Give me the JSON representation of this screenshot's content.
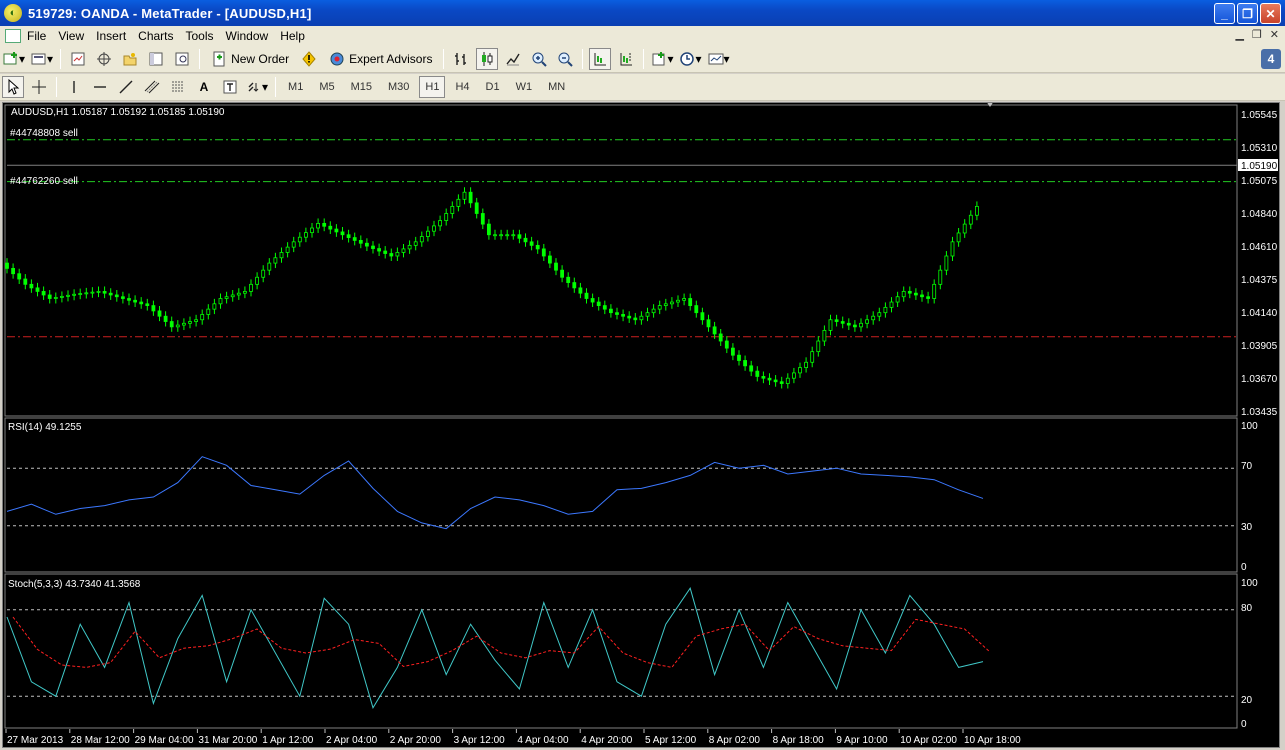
{
  "window": {
    "title": "519729: OANDA - MetaTrader - [AUDUSD,H1]"
  },
  "menu": [
    "File",
    "View",
    "Insert",
    "Charts",
    "Tools",
    "Window",
    "Help"
  ],
  "toolbar": {
    "new_order_label": "New Order",
    "expert_advisors_label": "Expert Advisors",
    "count_badge": "4"
  },
  "timeframes": [
    {
      "label": "M1",
      "active": false
    },
    {
      "label": "M5",
      "active": false
    },
    {
      "label": "M15",
      "active": false
    },
    {
      "label": "M30",
      "active": false
    },
    {
      "label": "H1",
      "active": true
    },
    {
      "label": "H4",
      "active": false
    },
    {
      "label": "D1",
      "active": false
    },
    {
      "label": "W1",
      "active": false
    },
    {
      "label": "MN",
      "active": false
    }
  ],
  "chart": {
    "header": "AUDUSD,H1  1.05187 1.05192 1.05185 1.05190",
    "order_labels": [
      "#44748808 sell",
      "#44762260 sell"
    ],
    "price_axis": [
      "1.05545",
      "1.05310",
      "1.05075",
      "1.04840",
      "1.04610",
      "1.04375",
      "1.04140",
      "1.03905",
      "1.03670",
      "1.03435"
    ],
    "current_price": "1.05190",
    "rsi_label": "RSI(14) 49.1255",
    "rsi_axis": [
      "100",
      "70",
      "30",
      "0"
    ],
    "stoch_label": "Stoch(5,3,3) 43.7340 41.3568",
    "stoch_axis": [
      "100",
      "80",
      "20",
      "0"
    ],
    "time_axis": [
      "27 Mar 2013",
      "28 Mar 12:00",
      "29 Mar 04:00",
      "31 Mar 20:00",
      "1 Apr 12:00",
      "2 Apr 04:00",
      "2 Apr 20:00",
      "3 Apr 12:00",
      "4 Apr 04:00",
      "4 Apr 20:00",
      "5 Apr 12:00",
      "8 Apr 02:00",
      "8 Apr 18:00",
      "9 Apr 10:00",
      "10 Apr 02:00",
      "10 Apr 18:00"
    ],
    "colors": {
      "candles": "#00ff00",
      "rsi": "#3c78ff",
      "stoch_main": "#40c8c8",
      "stoch_signal": "#ff2020",
      "sell_lines": "#22cc22",
      "stop_line": "#cc2020"
    }
  },
  "chart_data": {
    "type": "line",
    "symbol": "AUDUSD",
    "timeframe": "H1",
    "ohlc_last": {
      "open": 1.05187,
      "high": 1.05192,
      "low": 1.05185,
      "close": 1.0519
    },
    "price_ylim": [
      1.03435,
      1.05545
    ],
    "x": [
      0,
      5,
      10,
      15,
      20,
      25,
      30,
      35,
      40,
      45,
      50,
      55,
      60,
      65,
      70,
      75,
      80,
      85,
      90,
      95,
      100,
      105,
      110,
      115,
      120,
      125,
      130,
      135,
      140,
      145,
      150,
      155,
      160,
      165,
      170,
      175,
      180,
      185,
      190,
      195,
      200
    ],
    "close": [
      1.045,
      1.0435,
      1.0425,
      1.0428,
      1.043,
      1.0425,
      1.042,
      1.0405,
      1.041,
      1.0425,
      1.043,
      1.045,
      1.0465,
      1.0478,
      1.047,
      1.0462,
      1.0455,
      1.0465,
      1.048,
      1.05,
      1.047,
      1.047,
      1.046,
      1.044,
      1.0425,
      1.0415,
      1.041,
      1.042,
      1.0425,
      1.0405,
      1.0385,
      1.037,
      1.0365,
      1.038,
      1.041,
      1.0405,
      1.0415,
      1.043,
      1.0425,
      1.0465,
      1.049
    ],
    "rsi": [
      40,
      45,
      38,
      42,
      44,
      48,
      50,
      60,
      78,
      72,
      58,
      55,
      52,
      65,
      75,
      56,
      40,
      32,
      28,
      42,
      50,
      48,
      44,
      38,
      40,
      55,
      56,
      60,
      65,
      74,
      70,
      72,
      66,
      68,
      70,
      66,
      65,
      64,
      62,
      55,
      49
    ],
    "stoch_main": [
      75,
      30,
      20,
      70,
      40,
      85,
      15,
      60,
      90,
      30,
      80,
      50,
      20,
      88,
      70,
      12,
      40,
      80,
      35,
      70,
      45,
      25,
      85,
      40,
      80,
      30,
      20,
      70,
      95,
      35,
      80,
      40,
      85,
      55,
      25,
      80,
      50,
      90,
      70,
      40,
      44
    ],
    "rsi_levels": [
      30,
      70
    ],
    "stoch_levels": [
      20,
      80
    ],
    "order_levels": [
      {
        "label": "#44748808 sell",
        "price": 1.0537
      },
      {
        "label": "#44762260 sell",
        "price": 1.05075
      }
    ],
    "stop_level": 1.0398
  }
}
